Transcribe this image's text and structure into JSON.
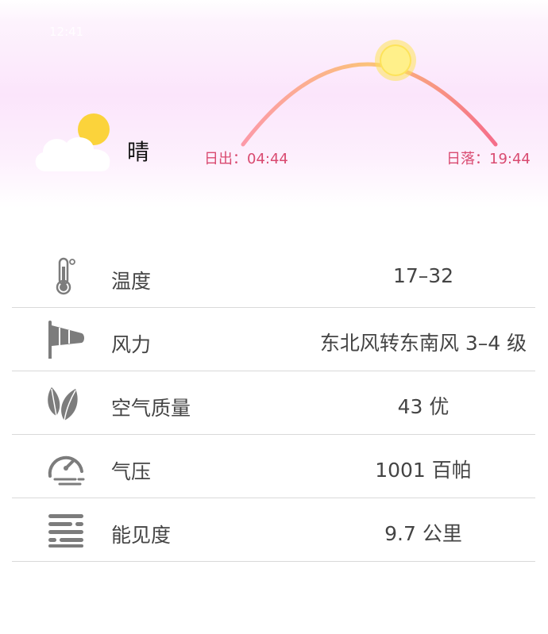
{
  "status": {
    "time": "12:41"
  },
  "current": {
    "condition": "晴",
    "icon": "sun-cloud-icon"
  },
  "sun": {
    "sunrise": "日出：04:44",
    "sunset": "日落：19:44"
  },
  "details": [
    {
      "icon": "thermometer-icon",
      "label": "温度",
      "value": "17–32"
    },
    {
      "icon": "windsock-icon",
      "label": "风力",
      "value": "东北风转东南风 3–4 级"
    },
    {
      "icon": "leaf-icon",
      "label": "空气质量",
      "value": "43 优"
    },
    {
      "icon": "gauge-icon",
      "label": "气压",
      "value": "1001 百帕"
    },
    {
      "icon": "visibility-icon",
      "label": "能见度",
      "value": "9.7 公里"
    }
  ],
  "colors": {
    "accent": "#d94a70",
    "sun": "#fde35a",
    "icon": "#7c7c7c"
  }
}
